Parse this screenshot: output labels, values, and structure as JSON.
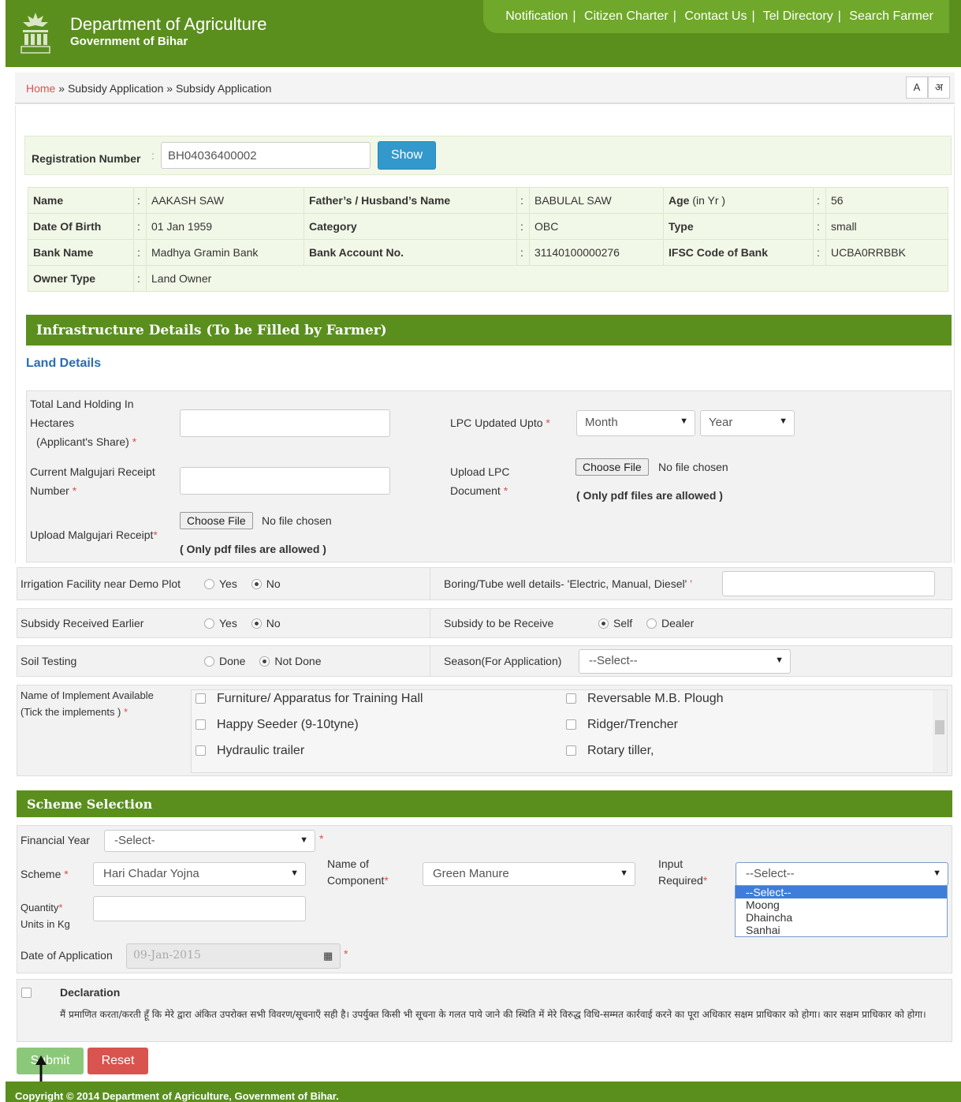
{
  "header": {
    "title": "Department of Agriculture",
    "subtitle": "Government of Bihar",
    "nav": [
      "Notification",
      "Citizen Charter",
      "Contact Us",
      "Tel Directory",
      "Search Farmer"
    ]
  },
  "breadcrumb": {
    "home": "Home",
    "sep": "»",
    "level1": "Subsidy Application",
    "level2": "Subsidy Application"
  },
  "font_buttons": [
    "A",
    "अ"
  ],
  "registration": {
    "label": "Registration Number",
    "colon": ":",
    "value": "BH04036400002",
    "button": "Show"
  },
  "farmer": {
    "rows": [
      [
        {
          "k": "Name",
          "v": "AAKASH SAW"
        },
        {
          "k": "Father’s / Husband’s Name",
          "v": "BABULAL SAW"
        },
        {
          "k": "Age",
          "k2": "(in Yr )",
          "v": "56"
        }
      ],
      [
        {
          "k": "Date Of Birth",
          "v": "01 Jan 1959"
        },
        {
          "k": "Category",
          "v": "OBC"
        },
        {
          "k": "Type",
          "v": "small"
        }
      ],
      [
        {
          "k": "Bank Name",
          "v": "Madhya Gramin Bank"
        },
        {
          "k": "Bank Account No.",
          "v": "31140100000276"
        },
        {
          "k": "IFSC Code of Bank",
          "v": "UCBA0RRBBK"
        }
      ]
    ],
    "owner_label": "Owner Type",
    "owner_value": "Land Owner",
    "colon": ":"
  },
  "infra": {
    "title": "Infrastructure Details (To be Filled by Farmer)",
    "land_title": "Land Details",
    "total_land_l1": "Total Land Holding In",
    "total_land_l2": "Hectares",
    "total_land_l3": "(Applicant's Share)",
    "lpc_label": "LPC Updated Upto",
    "lpc_month": "Month",
    "lpc_year": "Year",
    "malgujari_l1": "Current Malgujari Receipt",
    "malgujari_l2": "Number",
    "upload_lpc_l1": "Upload LPC",
    "upload_lpc_l2": "Document",
    "choose_file": "Choose File",
    "no_file": "No file chosen",
    "pdf_note": "( Only pdf files are allowed )",
    "upload_malgujari": "Upload Malgujari Receipt",
    "required_mark": "*"
  },
  "irrigation": {
    "label": "Irrigation Facility near Demo Plot",
    "yes": "Yes",
    "no": "No",
    "boring_label": "Boring/Tube well details- 'Electric, Manual, Diesel'",
    "boring_suffix": "'"
  },
  "subsidy": {
    "label": "Subsidy Received Earlier",
    "yes": "Yes",
    "no": "No",
    "receive_label": "Subsidy to be Receive",
    "self": "Self",
    "dealer": "Dealer"
  },
  "soil": {
    "label": "Soil Testing",
    "done": "Done",
    "not_done": "Not Done",
    "season_label": "Season(For Application)",
    "season_value": "--Select--"
  },
  "implements": {
    "label_l1": "Name of Implement Available",
    "label_l2": "(Tick the implements )",
    "left": [
      "Furniture/ Apparatus for Training Hall",
      "Happy Seeder (9-10tyne)",
      "Hydraulic trailer"
    ],
    "right": [
      "Reversable M.B. Plough",
      "Ridger/Trencher",
      "Rotary tiller,"
    ]
  },
  "scheme": {
    "title": "Scheme Selection",
    "fy_label": "Financial Year",
    "fy_value": "-Select-",
    "scheme_label": "Scheme",
    "scheme_value": "Hari Chadar Yojna",
    "component_l1": "Name of",
    "component_l2": "Component",
    "component_value": "Green Manure",
    "input_l1": "Input",
    "input_l2": "Required",
    "input_value": "--Select--",
    "input_options": [
      "--Select--",
      "Moong",
      "Dhaincha",
      "Sanhai"
    ],
    "qty_l1": "Quantity",
    "qty_l2": "Units in Kg",
    "date_label": "Date of Application",
    "date_value": "09-Jan-2015"
  },
  "declaration": {
    "title": "Declaration",
    "text": "मैं प्रमाणित करता/करती हूँ कि मेरे द्वारा अंकित उपरोक्त सभी विवरण/सूचनाएँ सही है। उपर्युक्त किसी भी सूचना के गलत पाये जाने की स्थिति में मेरे विरुद्ध विधि-सम्मत कार्रवाई करने का पूरा अधिकार सक्षम प्राधिकार को होगा। कार सक्षम प्राधिकार को होगा।"
  },
  "actions": {
    "submit": "Submit",
    "reset": "Reset"
  },
  "footer": "Copyright © 2014 Department of Agriculture, Government of Bihar."
}
